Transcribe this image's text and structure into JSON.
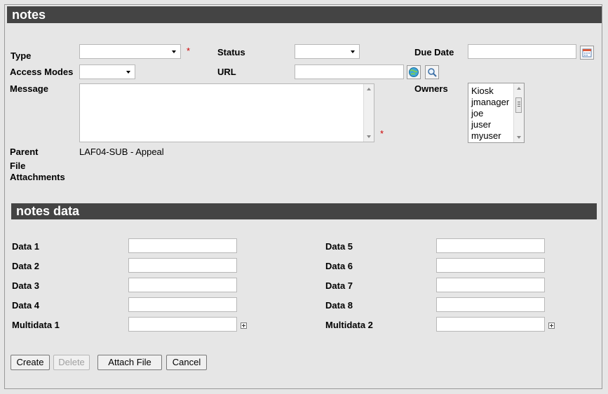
{
  "notes": {
    "title": "notes",
    "type_label": "Type",
    "status_label": "Status",
    "due_date_label": "Due Date",
    "access_modes_label": "Access Modes",
    "url_label": "URL",
    "message_label": "Message",
    "owners_label": "Owners",
    "parent_label": "Parent",
    "parent_value": "LAF04-SUB - Appeal",
    "file_label": "File",
    "attachments_label": "Attachments",
    "required_marker": "*",
    "owners": [
      "Kiosk",
      "jmanager",
      "joe",
      "juser",
      "myuser"
    ]
  },
  "notes_data": {
    "title": "notes data",
    "left_fields": [
      {
        "label": "Data 1"
      },
      {
        "label": "Data 2"
      },
      {
        "label": "Data 3"
      },
      {
        "label": "Data 4"
      },
      {
        "label": "Multidata 1"
      }
    ],
    "right_fields": [
      {
        "label": "Data 5"
      },
      {
        "label": "Data 6"
      },
      {
        "label": "Data 7"
      },
      {
        "label": "Data 8"
      },
      {
        "label": "Multidata 2"
      }
    ]
  },
  "buttons": {
    "create": "Create",
    "delete": "Delete",
    "attach_file": "Attach File",
    "cancel": "Cancel"
  },
  "colors": {
    "header_bar": "#444444",
    "background": "#e6e6e6",
    "required": "#cc0000"
  }
}
